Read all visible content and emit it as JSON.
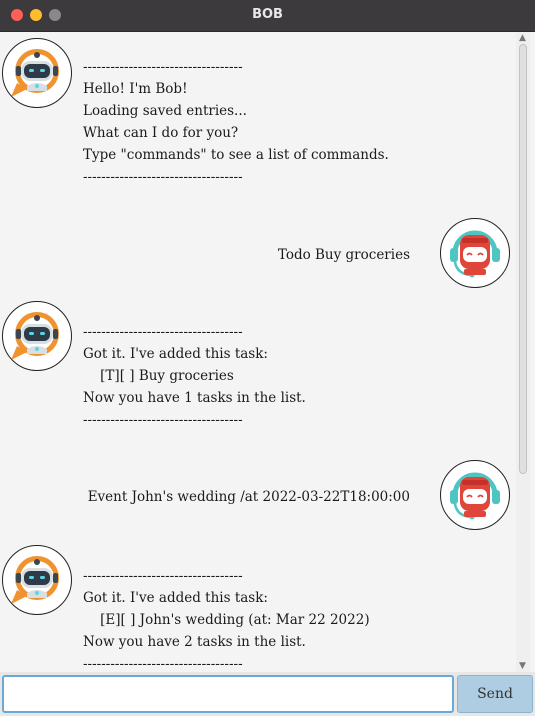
{
  "window": {
    "title": "BOB"
  },
  "messages": [
    {
      "sender": "bob",
      "avatar": "bob-robot-avatar",
      "text": "-----------------------------------\nHello! I'm Bob!\nLoading saved entries...\nWhat can I do for you?\nType \"commands\" to see a list of commands.\n-----------------------------------"
    },
    {
      "sender": "user",
      "avatar": "user-robot-avatar",
      "text": "Todo Buy groceries"
    },
    {
      "sender": "bob",
      "avatar": "bob-robot-avatar",
      "text": "-----------------------------------\nGot it. I've added this task:\n    [T][ ] Buy groceries\nNow you have 1 tasks in the list.\n-----------------------------------"
    },
    {
      "sender": "user",
      "avatar": "user-robot-avatar",
      "text": "Event John's wedding /at 2022-03-22T18:00:00"
    },
    {
      "sender": "bob",
      "avatar": "bob-robot-avatar",
      "text": "-----------------------------------\nGot it. I've added this task:\n    [E][ ] John's wedding (at: Mar 22 2022)\nNow you have 2 tasks in the list.\n-----------------------------------"
    }
  ],
  "input": {
    "value": "",
    "placeholder": ""
  },
  "send_label": "Send",
  "colors": {
    "bob_orange": "#f0922e",
    "user_red": "#e0453a",
    "teal": "#4ec5c1",
    "accent": "#6aa8d8"
  }
}
